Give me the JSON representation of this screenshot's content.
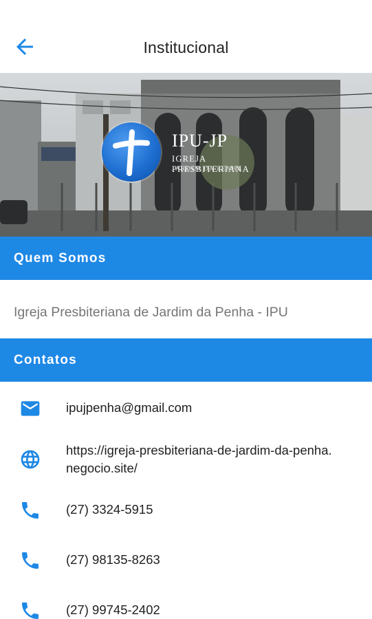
{
  "appbar": {
    "title": "Institucional",
    "back_icon": "arrow-back-icon"
  },
  "hero": {
    "logo_title": "IPU-JP",
    "logo_subtitle": "IGREJA PRESBITERIANA",
    "logo_tagline": "JARDIM DA PENHA",
    "logo_icon": "cross-logo-icon"
  },
  "sections": {
    "about_title": "Quem Somos",
    "about_text": "Igreja Presbiteriana de Jardim da Penha - IPU",
    "contacts_title": "Contatos"
  },
  "contacts": [
    {
      "icon": "email-icon",
      "value": "ipujpenha@gmail.com"
    },
    {
      "icon": "globe-icon",
      "value": "https://igreja-presbiteriana-de-jardim-da-penha.negocio.site/"
    },
    {
      "icon": "phone-icon",
      "value": "(27) 3324-5915"
    },
    {
      "icon": "phone-icon",
      "value": "(27) 98135-8263"
    },
    {
      "icon": "phone-icon",
      "value": "(27) 99745-2402"
    }
  ],
  "colors": {
    "accent": "#1e88e5",
    "icon": "#1e88e5",
    "muted_text": "#757575"
  }
}
